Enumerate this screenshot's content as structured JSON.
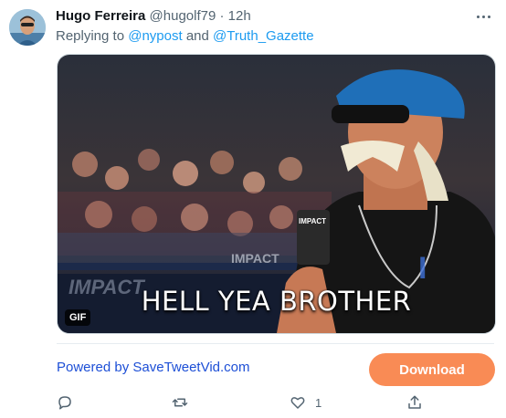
{
  "tweet": {
    "display_name": "Hugo Ferreira",
    "handle": "@hugolf79",
    "separator": "·",
    "time": "12h",
    "replying_prefix": "Replying to",
    "mention_1": "@nypost",
    "mention_joiner": "and",
    "mention_2": "@Truth_Gazette"
  },
  "media": {
    "caption": "HELL YEA BROTHER",
    "badge": "GIF"
  },
  "promo": {
    "powered_by": "Powered by SaveTweetVid.com",
    "download_label": "Download",
    "download_color": "#f98b55",
    "link_color": "#1d4fd6"
  },
  "actions": {
    "reply_icon": "reply-icon",
    "retweet_icon": "retweet-icon",
    "like_icon": "heart-icon",
    "like_count": "1",
    "share_icon": "share-icon"
  }
}
